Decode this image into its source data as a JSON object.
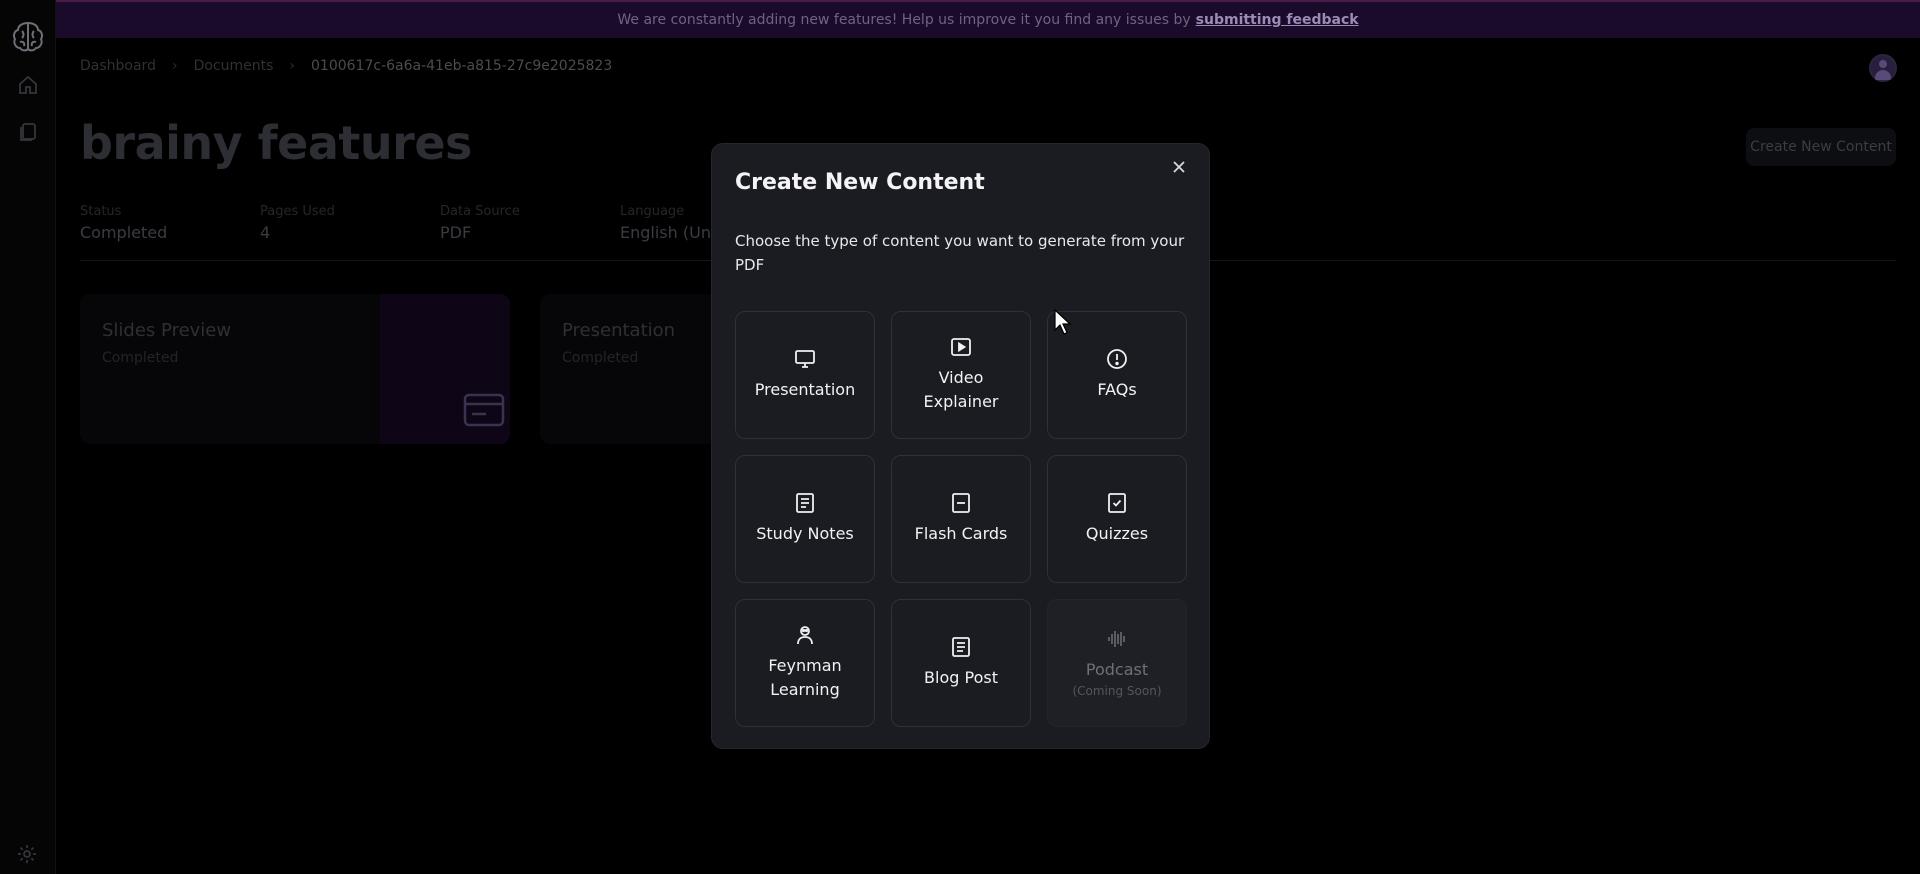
{
  "banner": {
    "text": "We are constantly adding new features! Help us improve it you find any issues by",
    "link": "submitting feedback"
  },
  "breadcrumb": {
    "items": [
      "Dashboard",
      "Documents",
      "0100617c-6a6a-41eb-a815-27c9e2025823"
    ]
  },
  "page": {
    "title": "brainy features",
    "create_button": "Create New Content"
  },
  "stats": [
    {
      "label": "Status",
      "value": "Completed"
    },
    {
      "label": "Pages Used",
      "value": "4"
    },
    {
      "label": "Data Source",
      "value": "PDF"
    },
    {
      "label": "Language",
      "value": "English (Unite"
    }
  ],
  "cards": [
    {
      "title": "Slides Preview",
      "status": "Completed"
    },
    {
      "title": "Presentation",
      "status": "Completed"
    }
  ],
  "modal": {
    "title": "Create New Content",
    "description": "Choose the type of content you want to generate from your PDF",
    "options": [
      {
        "label": "Presentation",
        "icon": "monitor-icon"
      },
      {
        "label": "Video Explainer",
        "icon": "video-icon"
      },
      {
        "label": "FAQs",
        "icon": "info-circle-icon"
      },
      {
        "label": "Study Notes",
        "icon": "notes-icon"
      },
      {
        "label": "Flash Cards",
        "icon": "flash-card-icon"
      },
      {
        "label": "Quizzes",
        "icon": "quiz-check-icon"
      },
      {
        "label": "Feynman Learning",
        "icon": "person-icon"
      },
      {
        "label": "Blog Post",
        "icon": "document-icon"
      },
      {
        "label": "Podcast",
        "icon": "audio-wave-icon",
        "sub": "(Coming Soon)"
      }
    ]
  }
}
